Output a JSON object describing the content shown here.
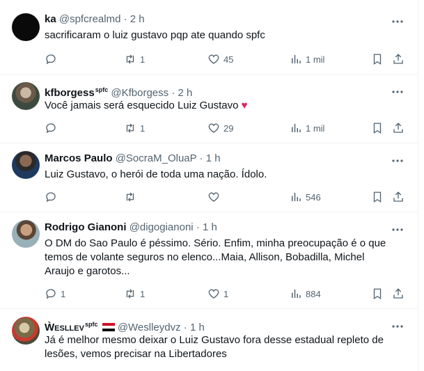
{
  "tweets": [
    {
      "name": "ka",
      "badge": "",
      "handle": "@spfcrealmd",
      "time": "2 h",
      "text": "sacrificaram o luiz gustavo pqp ate quando spfc",
      "replies": "",
      "retweets": "1",
      "likes": "45",
      "views": "1 mil"
    },
    {
      "name": "kfborgess",
      "badge": "spfc",
      "handle": "@Kfborgess",
      "time": "2 h",
      "text": "Você jamais será esquecido Luiz Gustavo ",
      "emoji": "♥",
      "replies": "",
      "retweets": "1",
      "likes": "29",
      "views": "1 mil"
    },
    {
      "name": "Marcos Paulo",
      "badge": "",
      "handle": "@SocraM_OluaP",
      "time": "1 h",
      "text": "Luiz Gustavo, o herói de toda uma nação. Ídolo.",
      "replies": "",
      "retweets": "",
      "likes": "",
      "views": "546"
    },
    {
      "name": "Rodrigo Gianoni",
      "badge": "",
      "handle": "@digogianoni",
      "time": "1 h",
      "text_lines": [
        "O DM do Sao Paulo é péssimo. Sério. Enfim, minha preocupação é o que",
        "temos de volante seguros no elenco...Maia, Allison, Bobadilla, Michel",
        "Araujo e garotos..."
      ],
      "replies": "1",
      "retweets": "1",
      "likes": "1",
      "views": "884"
    },
    {
      "name": "Ẁesllev",
      "badge": "spfc",
      "handle": "@Weslleydvz",
      "time": "1 h",
      "text_lines": [
        "Já é melhor mesmo deixar o Luiz Gustavo fora desse estadual repleto de",
        "lesões, vemos precisar na Libertadores"
      ]
    }
  ],
  "separator": "·",
  "icons": [
    "more-icon",
    "reply-icon",
    "retweet-icon",
    "like-icon",
    "views-icon",
    "bookmark-icon",
    "share-icon"
  ],
  "colors": {
    "text": "#0f1419",
    "muted": "#536471",
    "border": "#eff3f4",
    "heart": "#e0245e"
  }
}
